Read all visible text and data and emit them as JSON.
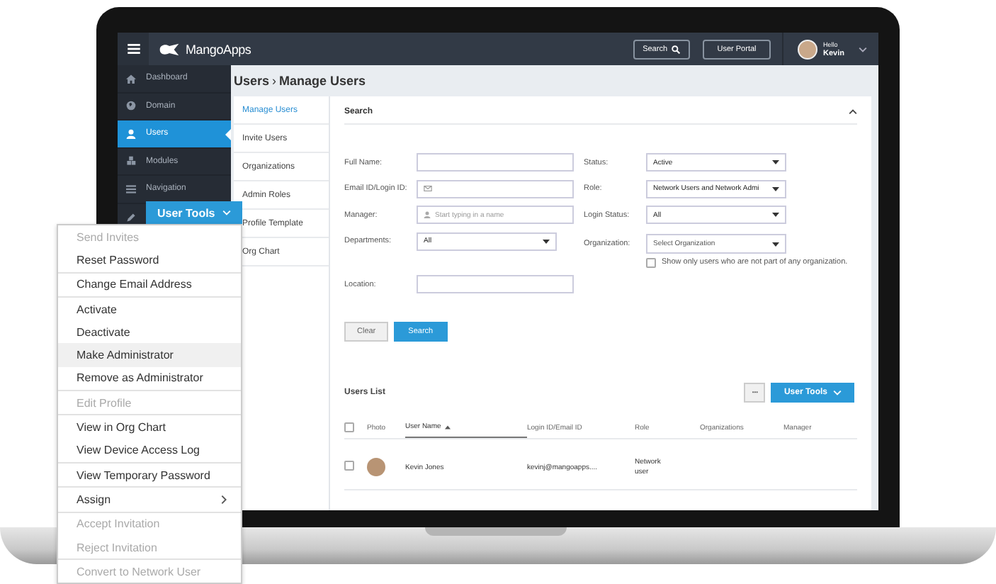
{
  "topbar": {
    "logo": "MangoApps",
    "search_button": "Search",
    "portal_button": "User Portal",
    "greeting": "Hello",
    "user_name": "Kevin"
  },
  "sidebar": {
    "items": [
      {
        "label": "Dashboard",
        "selected": false
      },
      {
        "label": "Domain",
        "selected": false
      },
      {
        "label": "Users",
        "selected": true
      },
      {
        "label": "Modules",
        "selected": false
      },
      {
        "label": "Navigation",
        "selected": false
      }
    ]
  },
  "breadcrumb": {
    "section": "Users",
    "separator": "›",
    "page": "Manage Users"
  },
  "subnav": [
    {
      "label": "Manage Users",
      "selected": true
    },
    {
      "label": "Invite Users",
      "selected": false
    },
    {
      "label": "Organizations",
      "selected": false
    },
    {
      "label": "Admin Roles",
      "selected": false
    },
    {
      "label": "Profile Template",
      "selected": false
    },
    {
      "label": "Org Chart",
      "selected": false
    }
  ],
  "search": {
    "title": "Search",
    "left_fields": [
      {
        "kind": "text",
        "label": "Full Name:"
      },
      {
        "kind": "email",
        "label": "Email ID/Login ID:"
      },
      {
        "kind": "person",
        "label": "Manager:",
        "placeholder": "Start typing in a name"
      },
      {
        "kind": "select",
        "label": "Departments:",
        "value": "All"
      },
      {
        "kind": "text",
        "label": "Location:"
      }
    ],
    "right_fields": [
      {
        "kind": "select",
        "label": "Status:",
        "value": "Active"
      },
      {
        "kind": "select",
        "label": "Role:",
        "value": "Network Users and Network Admi"
      },
      {
        "kind": "select",
        "label": "Login Status:",
        "value": "All"
      },
      {
        "kind": "select",
        "label": "Organization:",
        "value": "Select Organization"
      }
    ],
    "org_checkbox": {
      "label": "Show only users who are not part of any organization.",
      "checked": false
    },
    "buttons": [
      "Clear",
      "Search"
    ]
  },
  "users_list": {
    "title": "Users List",
    "more_button": "•••",
    "tools_button": "User Tools",
    "columns": [
      {
        "kind": "checkbox",
        "checked": false
      },
      {
        "label": "Photo",
        "sorted": false
      },
      {
        "label": "User Name",
        "sorted": true
      },
      {
        "label": "Login ID/Email ID",
        "sorted": false
      },
      {
        "label": "Role",
        "sorted": false
      },
      {
        "label": "Organizations",
        "sorted": false
      },
      {
        "label": "Manager",
        "sorted": false
      }
    ],
    "rows": [
      {
        "checked": false,
        "name": "Kevin Jones",
        "login": "kevinj@mangoapps....",
        "role": "Network user"
      }
    ]
  },
  "tools_menu": {
    "button": "User Tools",
    "groups": [
      {
        "items": [
          {
            "label": "Send Invites",
            "disabled": true,
            "selected": false
          },
          {
            "label": "Reset Password",
            "disabled": false,
            "selected": false
          }
        ]
      },
      {
        "items": [
          {
            "label": "Change Email Address",
            "disabled": false,
            "selected": false
          }
        ]
      },
      {
        "items": [
          {
            "label": "Activate",
            "disabled": false,
            "selected": false
          },
          {
            "label": "Deactivate",
            "disabled": false,
            "selected": false
          },
          {
            "label": "Make Administrator",
            "disabled": false,
            "selected": true
          },
          {
            "label": "Remove as Administrator",
            "disabled": false,
            "selected": false
          }
        ]
      },
      {
        "items": [
          {
            "label": "Edit Profile",
            "disabled": true,
            "selected": false
          }
        ]
      },
      {
        "items": [
          {
            "label": "View in Org Chart",
            "disabled": false,
            "selected": false
          },
          {
            "label": "View Device Access Log",
            "disabled": false,
            "selected": false
          }
        ]
      },
      {
        "items": [
          {
            "label": "View Temporary Password",
            "disabled": false,
            "selected": false
          }
        ]
      },
      {
        "items": [
          {
            "label": "Assign",
            "kind": "submenu",
            "disabled": false,
            "selected": false
          }
        ]
      },
      {
        "items": [
          {
            "label": "Accept Invitation",
            "disabled": true,
            "selected": false
          },
          {
            "label": "Reject Invitation",
            "disabled": true,
            "selected": false
          }
        ]
      },
      {
        "items": [
          {
            "label": "Convert to Network User",
            "disabled": true,
            "selected": false
          }
        ]
      }
    ]
  }
}
